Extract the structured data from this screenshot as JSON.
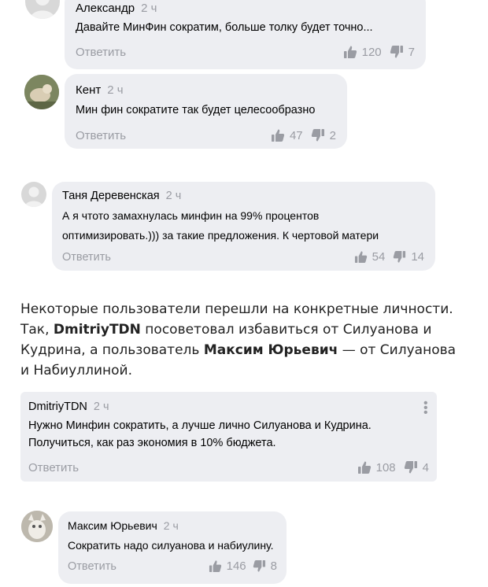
{
  "comments": [
    {
      "author": "Александр",
      "time": "2 ч",
      "text_lines": [
        "Давайте МинФин сократим, больше толку будет точно..."
      ],
      "reply_label": "Ответить",
      "likes": "120",
      "dislikes": "7"
    },
    {
      "author": "Кент",
      "time": "2 ч",
      "text_lines": [
        "Мин фин сократите так будет целесообразно"
      ],
      "reply_label": "Ответить",
      "likes": "47",
      "dislikes": "2"
    },
    {
      "author": "Таня Деревенская",
      "time": "2 ч",
      "text_lines": [
        "А я чтото замахнулась минфин на 99% процентов",
        "оптимизировать.))) за такие предложения. К чертовой матери"
      ],
      "reply_label": "Ответить",
      "likes": "54",
      "dislikes": "14"
    },
    {
      "author": "DmitriyTDN",
      "time": "2 ч",
      "text_lines": [
        "Нужно Минфин сократить, а лучше лично Силуанова и Кудрина.",
        "Получиться, как раз экономия в 10% бюджета."
      ],
      "reply_label": "Ответить",
      "likes": "108",
      "dislikes": "4"
    },
    {
      "author": "Максим Юрьевич",
      "time": "2 ч",
      "text_lines": [
        "Сократить надо силуанова и набиулину."
      ],
      "reply_label": "Ответить",
      "likes": "146",
      "dislikes": "8"
    }
  ],
  "article": {
    "p1": "Некоторые пользователи перешли на конкретные личности. Так, ",
    "b1": "DmitriyTDN",
    "p2": " посоветовал избавиться от Силуанова и Кудрина, а пользователь ",
    "b2": "Максим Юрьевич",
    "p3": " — от Силуанова и Набиуллиной."
  },
  "colors": {
    "bubble": "#edeef2",
    "muted": "#9a9ca3",
    "panel": "#ffffff"
  }
}
